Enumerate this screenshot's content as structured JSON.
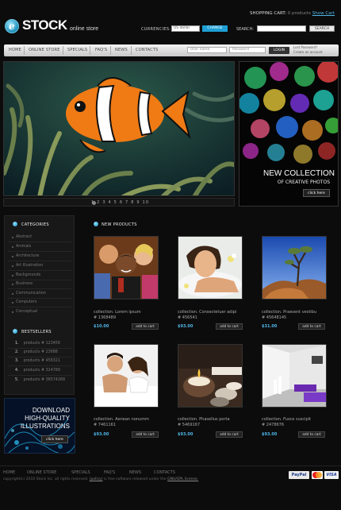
{
  "brand": {
    "name": "STOCK",
    "tagline": "online store",
    "logo_letter": "e"
  },
  "cart": {
    "label": "SHOPPING CART:",
    "count": "0 products",
    "link": "Show Cart"
  },
  "currencies": {
    "label": "CURRENCIES:",
    "selected": "US dollar",
    "button": "CHANGE"
  },
  "search": {
    "label": "SEARCH:",
    "placeholder": "",
    "button": "SEARCH"
  },
  "nav": [
    "HOME",
    "ONLINE STORE",
    "SPECIALS",
    "FAQ'S",
    "NEWS",
    "CONTACTS"
  ],
  "login": {
    "username_placeholder": "User name",
    "password_placeholder": "Password",
    "button": "LOGIN",
    "lost_password": "Lost Password?",
    "create_account": "Create an account"
  },
  "hero": {
    "pager": "1 2 3 4 5 6 7 8 9 10"
  },
  "collection": {
    "title": "NEW COLLECTION",
    "subtitle": "OF CREATIVE PHOTOS",
    "button": "click here"
  },
  "categories": {
    "title": "CATEGORIES",
    "items": [
      "Abstract",
      "Animals",
      "Architecture",
      "Art Illustration",
      "Backgrounds",
      "Business",
      "Communication",
      "Computers",
      "Conceptual"
    ]
  },
  "bestsellers": {
    "title": "BESTSELLERS",
    "items": [
      {
        "num": "1.",
        "label": "products # 123456"
      },
      {
        "num": "2.",
        "label": "products # 23688"
      },
      {
        "num": "3.",
        "label": "products # 456321"
      },
      {
        "num": "4.",
        "label": "products # 324789"
      },
      {
        "num": "5.",
        "label": "products # 36574268"
      }
    ]
  },
  "download": {
    "line1": "DOWNLOAD",
    "line2": "HIGH-QUALITY",
    "line3": "ILLUSTRATIONS",
    "button": "click here"
  },
  "products": {
    "title": "NEW PRODUCTS",
    "add_label": "add to cart",
    "items": [
      {
        "title": "collection. Lorem ipsum",
        "id": "# 1368489",
        "price": "$10.00",
        "image": "party-people"
      },
      {
        "title": "collection. Consectetuer adipi",
        "id": "# 456541",
        "price": "$93.00",
        "image": "spa-woman"
      },
      {
        "title": "collection. Praesent vestibu",
        "id": "# 45648145",
        "price": "$31.00",
        "image": "desert-tree"
      },
      {
        "title": "collection. Aenean nonumm",
        "id": "# 7461161",
        "price": "$93.00",
        "image": "couple-bed"
      },
      {
        "title": "collection. Phasellus porta",
        "id": "# 5469167",
        "price": "$93.00",
        "image": "candle-stones"
      },
      {
        "title": "collection. Fusce suscipit",
        "id": "# 2478676",
        "price": "$93.00",
        "image": "purple-room"
      }
    ]
  },
  "footer": {
    "nav": [
      "HOME",
      "ONLINE STORE",
      "SPECIALS",
      "FAQ'S",
      "NEWS",
      "CONTACTS"
    ],
    "copyright_pre": "copyright(c) 2010 Stock Inc. all rights reserved.",
    "privacy": "(policy)",
    "copyright_mid": "is free software released under the",
    "license": "GNU/GPL license.",
    "payments": [
      "PayPal",
      "MC",
      "VISA"
    ]
  },
  "colors": {
    "accent": "#1f9fd4",
    "link": "#4fb4e6",
    "background": "#0c0c0c"
  }
}
